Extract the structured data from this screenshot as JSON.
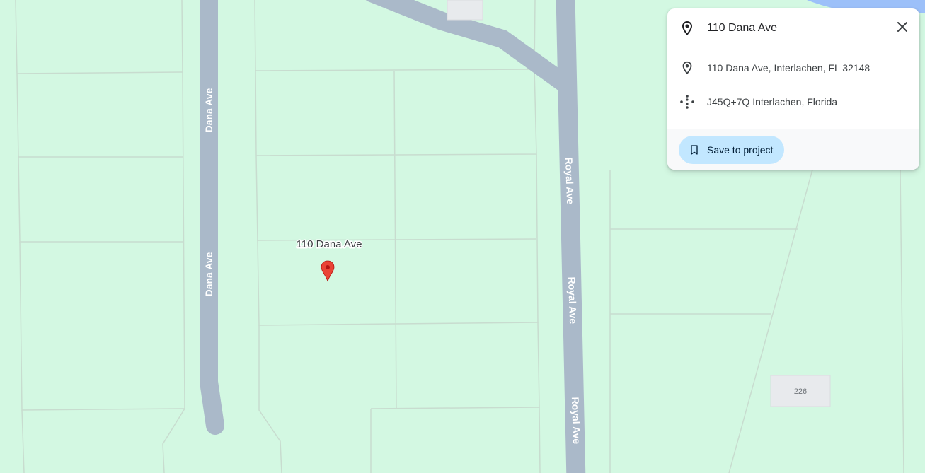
{
  "map": {
    "roads": {
      "dana_ave_labels": [
        "Dana Ave",
        "Dana Ave"
      ],
      "royal_ave_labels": [
        "Royal Ave",
        "Royal Ave",
        "Royal Ave"
      ]
    },
    "pin_label": "110 Dana Ave",
    "building_number": "226",
    "colors": {
      "land": "#d3f8e2",
      "road": "#aab9c9",
      "water": "#9cc0f9",
      "parcel_line": "#c8dccf",
      "pin": "#ea4335"
    }
  },
  "info_card": {
    "title": "110 Dana Ave",
    "address": "110 Dana Ave, Interlachen, FL 32148",
    "plus_code": "J45Q+7Q Interlachen, Florida",
    "save_button_label": "Save to project",
    "icons": {
      "title": "location-pin-icon",
      "address": "location-pin-icon",
      "plus_code": "plus-code-icon",
      "close": "close-icon",
      "save": "bookmark-icon"
    },
    "colors": {
      "save_button_bg": "#c2e7ff"
    }
  }
}
